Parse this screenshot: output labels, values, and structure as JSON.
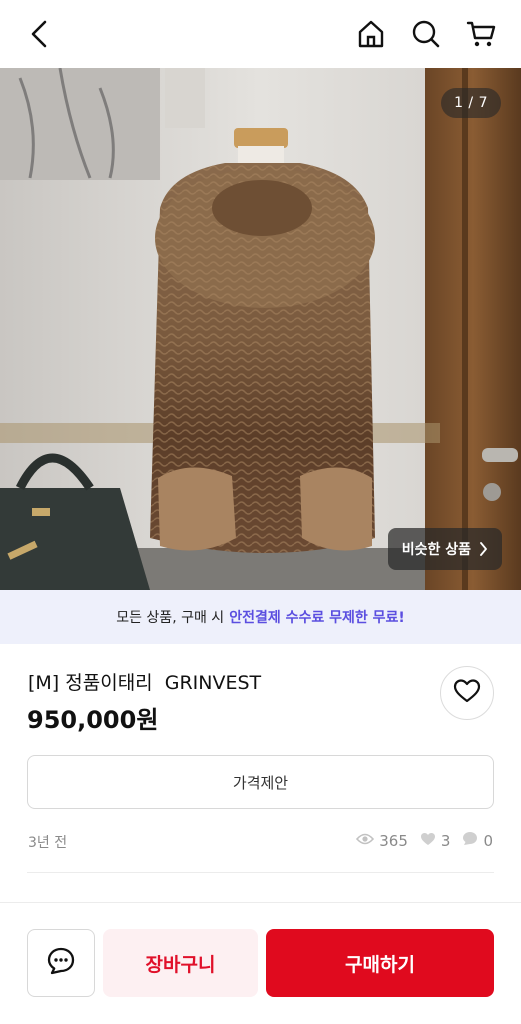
{
  "header": {
    "icons": [
      "back-icon",
      "home-icon",
      "search-icon",
      "cart-icon"
    ]
  },
  "gallery": {
    "counter": "1 / 7",
    "similar_label": "비슷한 상품"
  },
  "promo": {
    "prefix": "모든 상품, 구매 시",
    "highlight": "안전결제 수수료 무제한 무료!"
  },
  "product": {
    "title": "[M] 정품이태리  GRINVEST",
    "price": "950,000원"
  },
  "offer_label": "가격제안",
  "meta": {
    "time": "3년 전",
    "views": "365",
    "likes": "3",
    "chats": "0"
  },
  "actions": {
    "cart_label": "장바구니",
    "buy_label": "구매하기"
  },
  "colors": {
    "accent_red": "#e00a1e",
    "promo_purple": "#5b4ee0",
    "promo_bg": "#eef0fb"
  }
}
